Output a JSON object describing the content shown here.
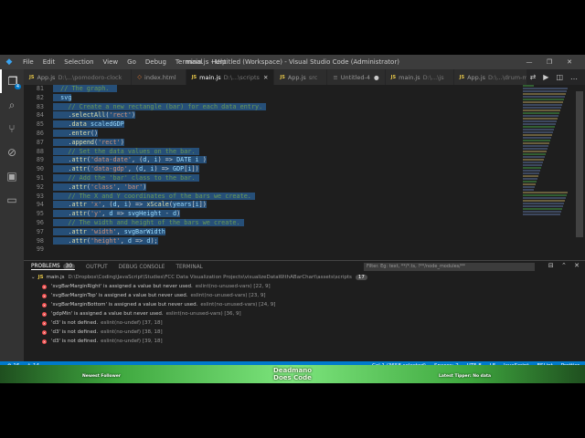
{
  "titlebar": {
    "menu": [
      "File",
      "Edit",
      "Selection",
      "View",
      "Go",
      "Debug",
      "Terminal",
      "Help"
    ],
    "title": "main.js - Untitled (Workspace) - Visual Studio Code (Administrator)"
  },
  "activity": {
    "badge": "4"
  },
  "tabs": [
    {
      "type": "js",
      "name": "App.js",
      "path": "D:\\...\\pomodoro-clock",
      "active": false,
      "dirty": false
    },
    {
      "type": "html",
      "name": "index.html",
      "path": "",
      "active": false,
      "dirty": false
    },
    {
      "type": "js",
      "name": "main.js",
      "path": "D:\\...\\scripts",
      "active": true,
      "dirty": false
    },
    {
      "type": "js",
      "name": "App.js",
      "path": "src",
      "active": false,
      "dirty": false
    },
    {
      "type": "none",
      "name": "Untitled-4",
      "path": "",
      "active": false,
      "dirty": true
    },
    {
      "type": "js",
      "name": "main.js",
      "path": "D:\\...\\js",
      "active": false,
      "dirty": false
    },
    {
      "type": "js",
      "name": "App.js",
      "path": "D:\\...\\drum-machine",
      "active": false,
      "dirty": false
    }
  ],
  "editor": {
    "lines": [
      {
        "n": "81",
        "tokens": [
          [
            "comment",
            "  // The graph.  "
          ]
        ]
      },
      {
        "n": "82",
        "tokens": [
          [
            "ident",
            "  svg"
          ]
        ]
      },
      {
        "n": "83",
        "tokens": [
          [
            "comment",
            "    // Create a new rectangle (bar) for each data entry. "
          ]
        ]
      },
      {
        "n": "84",
        "tokens": [
          [
            "plain",
            "    ."
          ],
          [
            "fn",
            "selectAll"
          ],
          [
            "plain",
            "("
          ],
          [
            "str",
            "'rect'"
          ],
          [
            "plain",
            ")"
          ]
        ]
      },
      {
        "n": "85",
        "tokens": [
          [
            "plain",
            "    ."
          ],
          [
            "fn",
            "data"
          ],
          [
            "plain",
            " "
          ],
          [
            "ident",
            "scaledGDP"
          ]
        ]
      },
      {
        "n": "86",
        "tokens": [
          [
            "plain",
            "    ."
          ],
          [
            "fn",
            "enter"
          ],
          [
            "plain",
            "()"
          ]
        ]
      },
      {
        "n": "87",
        "tokens": [
          [
            "plain",
            "    ."
          ],
          [
            "fn",
            "append"
          ],
          [
            "plain",
            "("
          ],
          [
            "str",
            "'rect'"
          ],
          [
            "plain",
            ")"
          ]
        ]
      },
      {
        "n": "88",
        "tokens": [
          [
            "comment",
            "    // Set the data values on the bar. "
          ]
        ]
      },
      {
        "n": "89",
        "tokens": [
          [
            "plain",
            "    ."
          ],
          [
            "fn",
            "attr"
          ],
          [
            "plain",
            "("
          ],
          [
            "str",
            "'data-date'"
          ],
          [
            "plain",
            ", ("
          ],
          [
            "ident",
            "d"
          ],
          [
            "plain",
            ", "
          ],
          [
            "ident",
            "i"
          ],
          [
            "plain",
            ") => "
          ],
          [
            "ident",
            "DATE"
          ],
          [
            "plain",
            " "
          ],
          [
            "ident",
            "i"
          ],
          [
            "plain",
            " )"
          ]
        ]
      },
      {
        "n": "90",
        "tokens": [
          [
            "plain",
            "    ."
          ],
          [
            "fn",
            "attr"
          ],
          [
            "plain",
            "("
          ],
          [
            "str",
            "'data-gdp'"
          ],
          [
            "plain",
            ", ("
          ],
          [
            "ident",
            "d"
          ],
          [
            "plain",
            ", "
          ],
          [
            "ident",
            "i"
          ],
          [
            "plain",
            ") => "
          ],
          [
            "ident",
            "GDP"
          ],
          [
            "plain",
            "["
          ],
          [
            "ident",
            "i"
          ],
          [
            "plain",
            "])"
          ]
        ]
      },
      {
        "n": "91",
        "tokens": [
          [
            "comment",
            "    // Add the 'bar' class to the bar. "
          ]
        ]
      },
      {
        "n": "92",
        "tokens": [
          [
            "plain",
            "    ."
          ],
          [
            "fn",
            "attr"
          ],
          [
            "plain",
            "("
          ],
          [
            "str",
            "'class'"
          ],
          [
            "plain",
            ", "
          ],
          [
            "str",
            "'bar'"
          ],
          [
            "plain",
            ")"
          ]
        ]
      },
      {
        "n": "93",
        "tokens": [
          [
            "comment",
            "    // The X and Y coordinates of the bars we create. "
          ]
        ]
      },
      {
        "n": "94",
        "tokens": [
          [
            "plain",
            "    ."
          ],
          [
            "fn",
            "attr"
          ],
          [
            "plain",
            " "
          ],
          [
            "str",
            "'x'"
          ],
          [
            "plain",
            ", ("
          ],
          [
            "ident",
            "d"
          ],
          [
            "plain",
            ", "
          ],
          [
            "ident",
            "i"
          ],
          [
            "plain",
            ") => "
          ],
          [
            "fn",
            "xScale"
          ],
          [
            "plain",
            "("
          ],
          [
            "ident",
            "years"
          ],
          [
            "plain",
            "["
          ],
          [
            "ident",
            "i"
          ],
          [
            "plain",
            "])"
          ]
        ]
      },
      {
        "n": "95",
        "tokens": [
          [
            "plain",
            "    ."
          ],
          [
            "fn",
            "attr"
          ],
          [
            "plain",
            "("
          ],
          [
            "str",
            "'y'"
          ],
          [
            "plain",
            ", "
          ],
          [
            "ident",
            "d"
          ],
          [
            "plain",
            " => "
          ],
          [
            "ident",
            "svgHeight"
          ],
          [
            "plain",
            " - "
          ],
          [
            "ident",
            "d"
          ],
          [
            "plain",
            ")"
          ]
        ]
      },
      {
        "n": "96",
        "tokens": [
          [
            "comment",
            "    // The width and height of the bars we create. "
          ]
        ]
      },
      {
        "n": "97",
        "tokens": [
          [
            "plain",
            "    ."
          ],
          [
            "fn",
            "attr"
          ],
          [
            "plain",
            " "
          ],
          [
            "str",
            "'width'"
          ],
          [
            "plain",
            ", "
          ],
          [
            "ident",
            "svgBarWidth"
          ]
        ]
      },
      {
        "n": "98",
        "tokens": [
          [
            "plain",
            "    ."
          ],
          [
            "fn",
            "attr"
          ],
          [
            "plain",
            "("
          ],
          [
            "str",
            "'height'"
          ],
          [
            "plain",
            ", "
          ],
          [
            "ident",
            "d"
          ],
          [
            "plain",
            " => "
          ],
          [
            "ident",
            "d"
          ],
          [
            "plain",
            ");"
          ]
        ]
      },
      {
        "n": "99",
        "tokens": [
          [
            "plain",
            ""
          ]
        ]
      }
    ]
  },
  "panel": {
    "tabs": [
      {
        "label": "PROBLEMS",
        "count": "30",
        "active": true
      },
      {
        "label": "OUTPUT",
        "count": "",
        "active": false
      },
      {
        "label": "DEBUG CONSOLE",
        "count": "",
        "active": false
      },
      {
        "label": "TERMINAL",
        "count": "",
        "active": false
      }
    ],
    "filter_placeholder": "Filter. Eg: text, **/*.ts, !**/node_modules/**",
    "file": {
      "name": "main.js",
      "path": "D:\\Dropbox\\Coding\\JavaScript\\Studies\\FCC Data Visualization Projects\\visualizeDataWithABarChart\\assets\\scripts",
      "count": "17"
    },
    "problems": [
      {
        "msg": "'svgBarMarginRight' is assigned a value but never used.",
        "rule": "eslint(no-unused-vars) [22, 9]"
      },
      {
        "msg": "'svgBarMarginTop' is assigned a value but never used.",
        "rule": "eslint(no-unused-vars) [23, 9]"
      },
      {
        "msg": "'svgBarMarginBottom' is assigned a value but never used.",
        "rule": "eslint(no-unused-vars) [24, 9]"
      },
      {
        "msg": "'gdpMin' is assigned a value but never used.",
        "rule": "eslint(no-unused-vars) [36, 9]"
      },
      {
        "msg": "'d3' is not defined.",
        "rule": "eslint(no-undef) [37, 18]"
      },
      {
        "msg": "'d3' is not defined.",
        "rule": "eslint(no-undef) [38, 18]"
      },
      {
        "msg": "'d3' is not defined.",
        "rule": "eslint(no-undef) [39, 18]"
      }
    ]
  },
  "statusbar": {
    "errors": "⊗ 16",
    "warnings": "⚠ 14",
    "position": "Col 1 (3658 selected)",
    "spaces": "Spaces: 2",
    "encoding": "UTF-8",
    "eol": "LF",
    "language": "JavaScript",
    "lint": "ESLint",
    "prettier": "Prettier"
  },
  "overlay": {
    "title_line1": "Deadmano",
    "title_line2": "Does Code",
    "label_left": "Newest Follower",
    "label_right": "Latest Tipper: No data"
  },
  "colors": {
    "accent": "#007acc",
    "selection": "#264f78",
    "error": "#f14c4c",
    "overlay_green": "#3fa83f"
  }
}
